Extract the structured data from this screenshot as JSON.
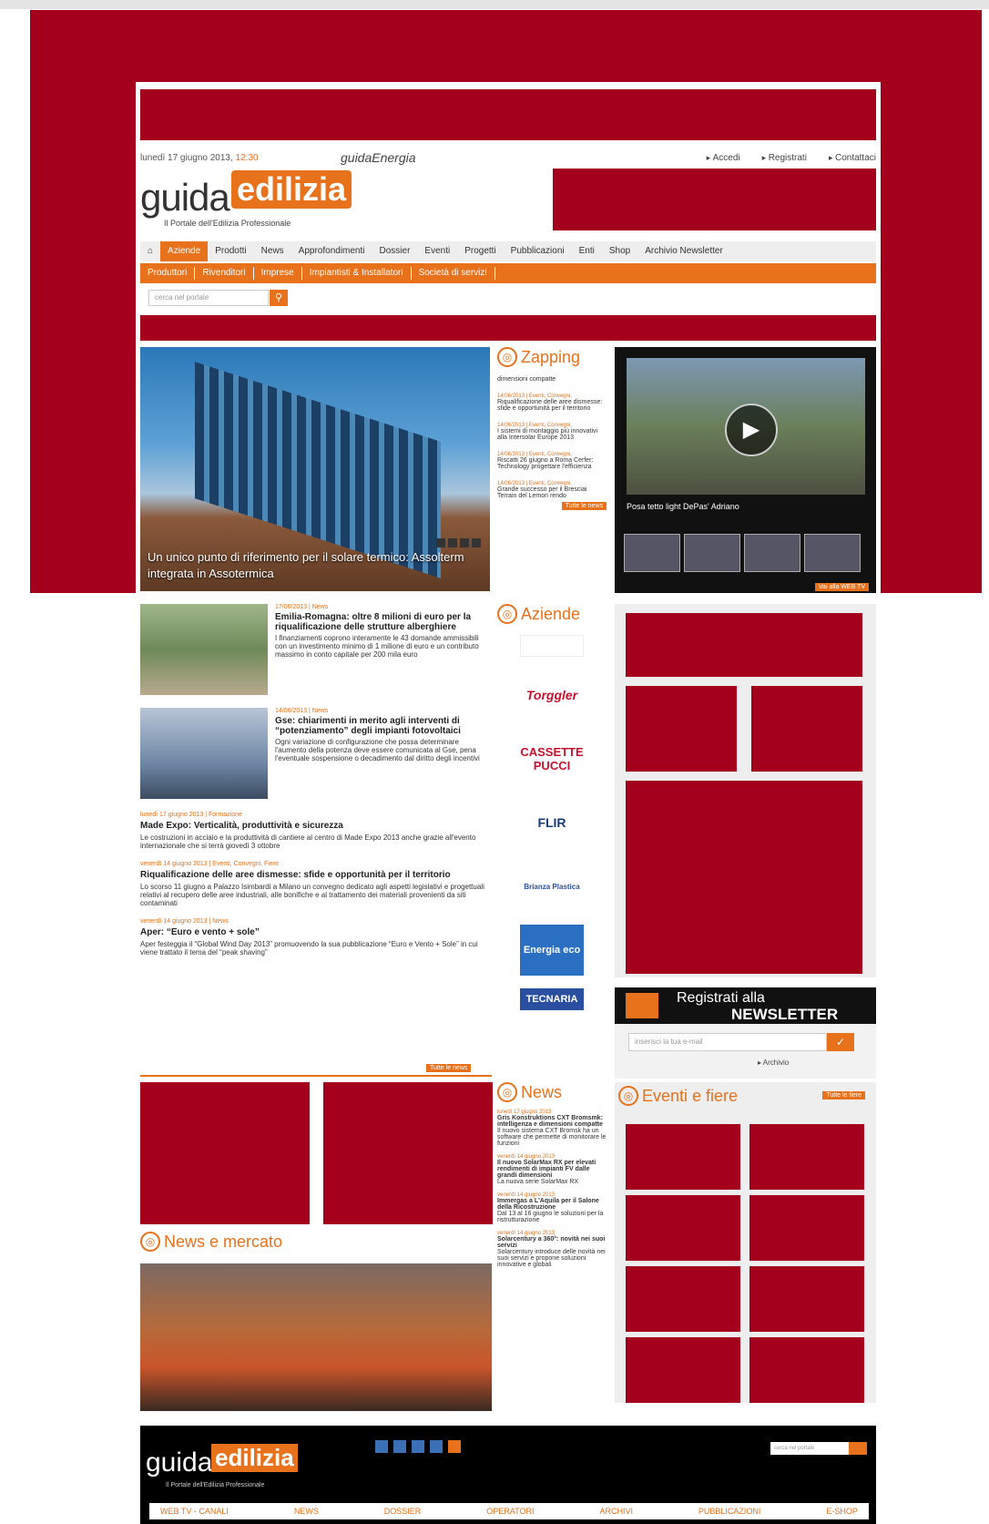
{
  "topbar": {
    "date": "lunedì 17 giugno 2013,",
    "time": "12:30",
    "guidaenergia": "guidaEnergia",
    "links": [
      "Accedi",
      "Registrati",
      "Contattaci"
    ]
  },
  "logo": {
    "guida": "guida",
    "edilizia": "edilizia",
    "tagline": "Il Portale dell'Edilizia Professionale"
  },
  "nav1": [
    "Aziende",
    "Prodotti",
    "News",
    "Approfondimenti",
    "Dossier",
    "Eventi",
    "Progetti",
    "Pubblicazioni",
    "Enti",
    "Shop",
    "Archivio Newsletter"
  ],
  "nav2": [
    "Produttori",
    "Rivenditori",
    "Imprese",
    "Impiantisti & Installatori",
    "Società di servizi"
  ],
  "search": {
    "placeholder": "cerca nel portale"
  },
  "hero": {
    "caption": "Un unico punto di riferimento per il solare termico: Assolterm integrata in Assotermica"
  },
  "zapping": {
    "title": "Zapping",
    "subtitle": "dimensioni compatte",
    "items": [
      {
        "date": "14/06/2013 | Eventi, Convegni,",
        "title": "Riqualificazione delle aree dismesse: sfide e opportunità per il territorio"
      },
      {
        "date": "14/06/2013 | Eventi, Convegni,",
        "title": "I sistemi di montaggio più innovativi alla Intersolar Europe 2013"
      },
      {
        "date": "14/06/2013 | Eventi, Convegni,",
        "title": "Riscatti 26 giugno a Roma Cerfer: Technology progettare l'efficienza"
      },
      {
        "date": "14/06/2013 | Eventi, Convegni,",
        "title": "Grande successo per il Bresciai Terrain del Lemon rendo"
      }
    ],
    "more": "Tutte le news"
  },
  "video": {
    "title": "Posa tetto light DePas' Adriano",
    "more": "Vai alla WEB TV"
  },
  "news": {
    "featured": [
      {
        "date": "17/06/2013 | News",
        "title": "Emilia-Romagna: oltre 8 milioni di euro per la riqualificazione delle strutture alberghiere",
        "body": "I finanziamenti coprono interamente le 43 domande ammissibili con un investimento minimo di 1 milione di euro e un contributo massimo in conto capitale per 200 mila euro"
      },
      {
        "date": "14/06/2013 | News",
        "title": "Gse: chiarimenti in merito agli interventi di “potenziamento” degli impianti fotovoltaici",
        "body": "Ogni variazione di configurazione che possa determinare l'aumento della potenza deve essere comunicata al Gse, pena l'eventuale sospensione o decadimento dal diritto degli incentivi"
      }
    ],
    "items": [
      {
        "date": "lunedì 17 giugno 2013 | Formazione",
        "title": "Made Expo: Verticalità, produttività e sicurezza",
        "body": "Le costruzioni in acciaio e la produttività di cantiere al centro di Made Expo 2013 anche grazie all'evento internazionale che si terrà giovedì 3 ottobre"
      },
      {
        "date": "venerdì 14 giugno 2013 | Eventi, Convegni, Fiere",
        "title": "Riqualificazione delle aree dismesse: sfide e opportunità per il territorio",
        "body": "Lo scorso 11 giugno a Palazzo Isimbardi a Milano un convegno dedicato agli aspetti legislativi e progettuali relativi al recupero delle aree industriali, alle bonifiche e al trattamento dei materiali provenienti da siti contaminati"
      },
      {
        "date": "venerdì 14 giugno 2013 | News",
        "title": "Aper: “Euro e vento + sole”",
        "body": "Aper festeggia il “Global Wind Day 2013” promuovendo la sua pubblicazione “Euro e Vento + Sole” in cui viene trattato il tema del “peak shaving”"
      }
    ],
    "more": "Tutte le news"
  },
  "aziende": {
    "title": "Aziende",
    "logos": [
      "Torggler",
      "CASSETTE PUCCI",
      "FLIR",
      "Brianza Plastica",
      "Energia eco",
      "TECNARIA"
    ]
  },
  "newsletter": {
    "line1": "Registrati alla",
    "line2": "NEWSLETTER",
    "placeholder": "inserisci la tua e-mail",
    "archive": "Archivio"
  },
  "news_mercato": {
    "title": "News e mercato"
  },
  "news2": {
    "title": "News",
    "items": [
      {
        "date": "lunedì 17 giugno 2013",
        "title": "Gris Konstruktions CXT Bromsmk: intelligenza e dimensioni compatte",
        "body": "Il nuovo sistema CXT Bromsk ha un software che permette di monitorare le funzioni"
      },
      {
        "date": "venerdì 14 giugno 2013",
        "title": "Il nuovo SolarMax RX per elevati rendimenti di impianti FV dalle grandi dimensioni",
        "body": "La nuova serie SolarMax RX"
      },
      {
        "date": "venerdì 14 giugno 2013",
        "title": "Immergas a L'Aquila per il Salone della Ricostruzione",
        "body": "Dal 13 al 16 giugno le soluzioni per la ristrutturazione"
      },
      {
        "date": "venerdì 14 giugno 2013",
        "title": "Solarcentury a 360°: novità nei suoi servizi",
        "body": "Solarcentury introduce delle novità nei suoi servizi e propone soluzioni innovative e globali"
      }
    ]
  },
  "eventi": {
    "title": "Eventi e fiere",
    "more": "Tutte le fiere"
  },
  "footer": {
    "guida": "guida",
    "edilizia": "edilizia",
    "tagline": "Il Portale dell'Edilizia Professionale",
    "search": "cerca nel portale",
    "nav": [
      "WEB TV - CANALI",
      "NEWS",
      "DOSSIER",
      "OPERATORI",
      "ARCHIVI",
      "PUBBLICAZIONI",
      "E-SHOP"
    ]
  },
  "colors": {
    "accent": "#e8711c",
    "ad": "#a4001e"
  }
}
